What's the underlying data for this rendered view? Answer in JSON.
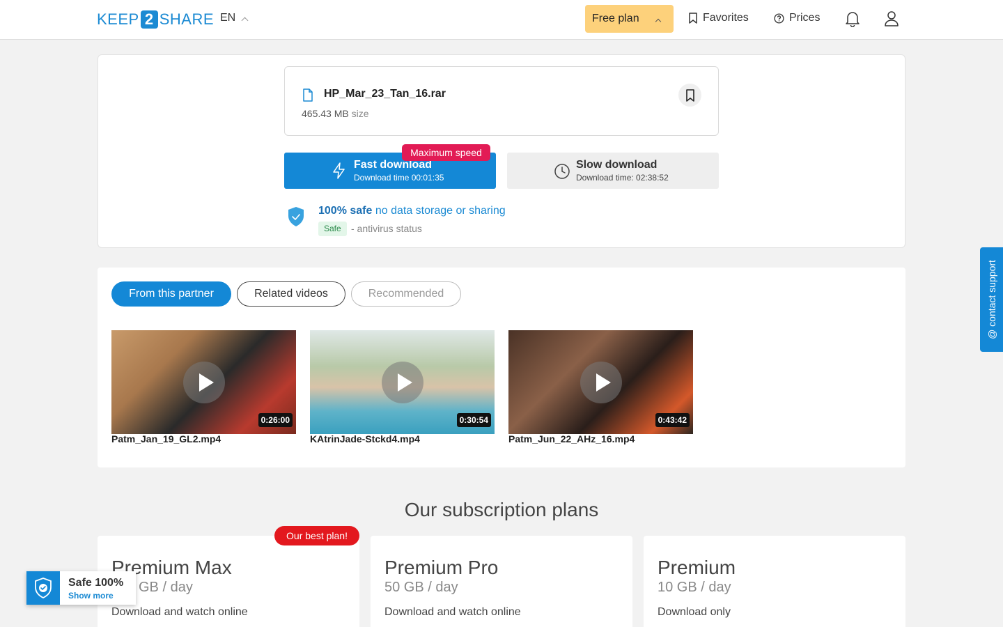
{
  "header": {
    "logo": {
      "left": "KEEP",
      "middle": "2",
      "right": "SHARE"
    },
    "language": "EN",
    "plan_button": "Free plan",
    "favorites": "Favorites",
    "prices": "Prices"
  },
  "file": {
    "name": "HP_Mar_23_Tan_16.rar",
    "size_value": "465.43 MB",
    "size_unit": "size"
  },
  "download": {
    "fast_title": "Fast download",
    "fast_time": "Download time 00:01:35",
    "badge": "Maximum speed",
    "slow_title": "Slow download",
    "slow_time": "Download time: 02:38:52"
  },
  "safety": {
    "strong": "100% safe",
    "rest": " no data storage or sharing",
    "badge": "Safe",
    "status": "- antivirus status"
  },
  "tabs": [
    "From this partner",
    "Related videos",
    "Recommended"
  ],
  "videos": [
    {
      "name": "Patm_Jan_19_GL2.mp4",
      "duration": "0:26:00"
    },
    {
      "name": "KAtrinJade-Stckd4.mp4",
      "duration": "0:30:54"
    },
    {
      "name": "Patm_Jun_22_AHz_16.mp4",
      "duration": "0:43:42"
    }
  ],
  "plans_title": "Our subscription plans",
  "plans": [
    {
      "name": "Premium Max",
      "quota": "GB / day",
      "desc": "Download and watch online",
      "badge": "Our best plan!"
    },
    {
      "name": "Premium Pro",
      "quota": "50 GB / day",
      "desc": "Download and watch online"
    },
    {
      "name": "Premium",
      "quota": "10 GB / day",
      "desc": "Download only"
    }
  ],
  "safe_widget": {
    "title": "Safe 100%",
    "link": "Show more"
  },
  "contact": "@ contact support",
  "colors": {
    "accent": "#1488d6",
    "plan_button": "#fdd17b",
    "badge_red": "#e21b55"
  }
}
